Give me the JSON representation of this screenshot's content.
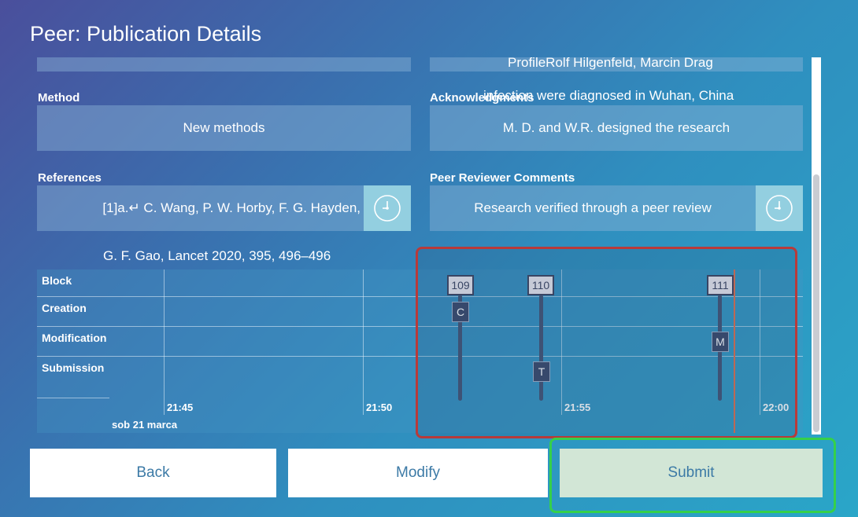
{
  "header": {
    "title": "Peer: Publication Details"
  },
  "fields": {
    "top_right_overflow": "ProfileRolf Hilgenfeld, Marcin Drag",
    "method": {
      "label": "Method",
      "value": "New methods"
    },
    "acknowledgments": {
      "label": "Acknowledgments",
      "overflow": "infection were diagnosed in Wuhan, China",
      "value": "M. D. and W.R. designed the research"
    },
    "references": {
      "label": "References",
      "value": "[1]a.↵ C. Wang, P. W. Horby, F. G. Hayden,",
      "overflow": "G. F. Gao, Lancet 2020, 395, 496–496"
    },
    "peer_comments": {
      "label": "Peer Reviewer Comments",
      "value": "Research verified through a peer review"
    }
  },
  "timeline": {
    "rows": [
      "Block",
      "Creation",
      "Modification",
      "Submission"
    ],
    "ticks": [
      "21:45",
      "21:50",
      "21:55",
      "22:00"
    ],
    "date": "sob 21 marca",
    "blocks": [
      "109",
      "110",
      "111"
    ],
    "events": [
      "C",
      "T",
      "M"
    ]
  },
  "buttons": {
    "back": "Back",
    "modify": "Modify",
    "submit": "Submit"
  },
  "colors": {
    "highlight_red": "#b83a3a",
    "highlight_green": "#35d04a",
    "now_line": "#e07050"
  }
}
